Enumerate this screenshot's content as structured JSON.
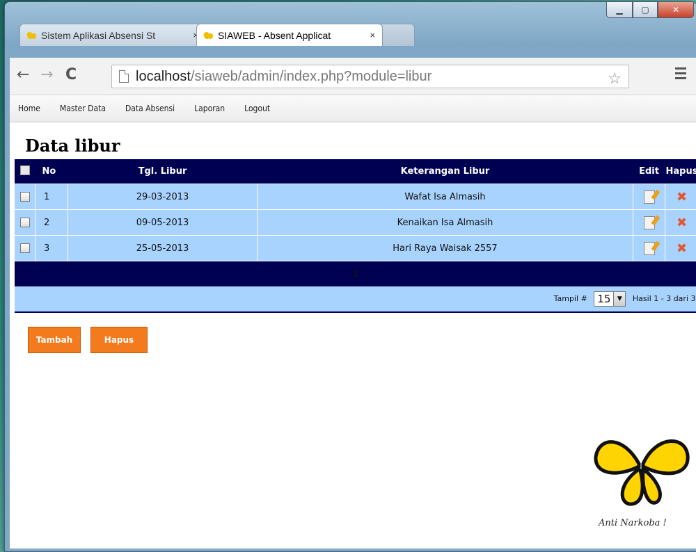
{
  "browser": {
    "tabs": [
      {
        "title": "Sistem Aplikasi Absensi St"
      },
      {
        "title": "SIAWEB - Absent Applicat"
      }
    ],
    "close_glyph": "×",
    "url_host": "localhost",
    "url_path": "/siaweb/admin/index.php?module=libur"
  },
  "menu": {
    "items": [
      "Home",
      "Master Data",
      "Data Absensi",
      "Laporan",
      "Logout"
    ]
  },
  "page_title": "Data libur",
  "table": {
    "headers": {
      "no": "No",
      "tgl": "Tgl. Libur",
      "ket": "Keterangan Libur",
      "edit": "Edit",
      "hapus": "Hapus"
    },
    "rows": [
      {
        "no": "1",
        "tgl": "29-03-2013",
        "ket": "Wafat Isa Almasih"
      },
      {
        "no": "2",
        "tgl": "09-05-2013",
        "ket": "Kenaikan Isa Almasih"
      },
      {
        "no": "3",
        "tgl": "25-05-2013",
        "ket": "Hari Raya Waisak 2557"
      }
    ],
    "page_number": "1",
    "tampil_label": "Tampil #",
    "tampil_value": "15",
    "hasil_text": "Hasil 1 - 3 dari 3"
  },
  "buttons": {
    "tambah": "Tambah",
    "hapus": "Hapus"
  },
  "logo_text": "Anti Narkoba !",
  "colors": {
    "header_bg": "#000052",
    "row_bg": "#a8d3ff",
    "button": "#f47a1e"
  }
}
